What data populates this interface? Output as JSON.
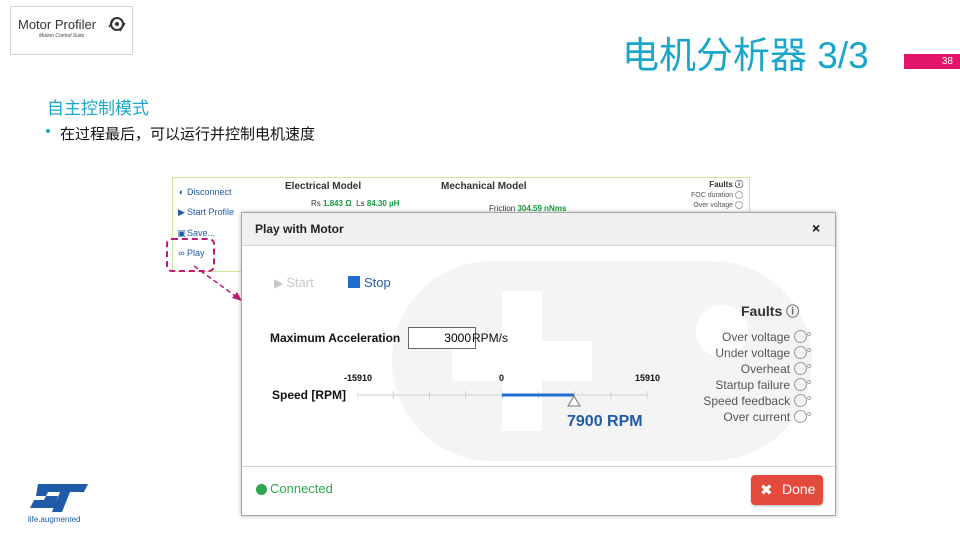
{
  "logo": {
    "title": "Motor Profiler",
    "subtitle": "Motion Control Suite",
    "icon": "motor-gear-icon"
  },
  "slide": {
    "title": "电机分析器 3/3",
    "page_number": "38",
    "heading": "自主控制模式",
    "bullet": "在过程最后，可以运行并控制电机速度"
  },
  "background_app": {
    "sidebar": [
      {
        "label": "Disconnect",
        "icon": "toggle-icon"
      },
      {
        "label": "Start Profile",
        "icon": "play-icon"
      },
      {
        "label": "Save...",
        "icon": "save-icon"
      },
      {
        "label": "Play",
        "icon": "gamepad-icon"
      }
    ],
    "electrical_model_label": "Electrical Model",
    "mechanical_model_label": "Mechanical Model",
    "rs_label": "Rs",
    "rs_value": "1.843 Ω",
    "ls_label": "Ls",
    "ls_value": "84.30 µH",
    "friction_label": "Friction",
    "friction_value": "304.59 nNms",
    "faults_label": "Faults",
    "faults": [
      "FOC duration",
      "Over voltage"
    ]
  },
  "modal": {
    "title": "Play with Motor",
    "close_label": "×",
    "start_label": "Start",
    "stop_label": "Stop",
    "max_accel_label": "Maximum Acceleration",
    "max_accel_value": "3000",
    "max_accel_unit": "RPM/s",
    "speed_label": "Speed [RPM]",
    "slider": {
      "min_label": "-15910",
      "zero_label": "0",
      "max_label": "15910",
      "min": -15910,
      "max": 15910,
      "value": 7900
    },
    "speed_readout": "7900 RPM",
    "faults_title": "Faults",
    "faults": [
      "Over voltage",
      "Under voltage",
      "Overheat",
      "Startup failure",
      "Speed feedback",
      "Over current"
    ],
    "status": "Connected",
    "done_label": "Done"
  },
  "footer": {
    "tagline": "life.augmented"
  },
  "colors": {
    "accent_cyan": "#1aa6cc",
    "accent_magenta": "#e3156a",
    "st_blue": "#1f5ba8",
    "connected_green": "#2ea84e",
    "done_red": "#e34a3c"
  }
}
